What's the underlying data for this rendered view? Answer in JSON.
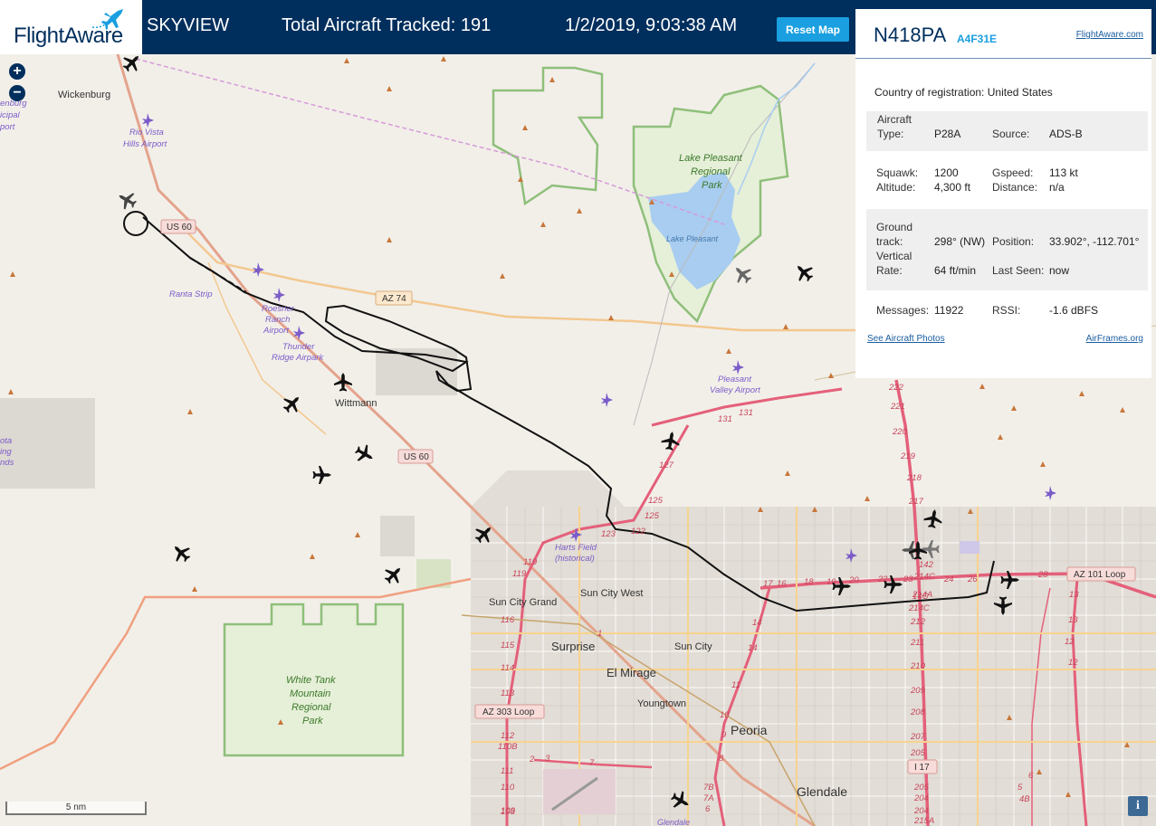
{
  "header": {
    "logo_text": "FlightAware",
    "app_name": "SKYVIEW",
    "tracked_label": "Total Aircraft Tracked: 191",
    "datetime": "1/2/2019, 9:03:38 AM",
    "reset_label": "Reset Map"
  },
  "map": {
    "zoom_in": "+",
    "zoom_out": "−",
    "scale": "5 nm",
    "info": "i",
    "places": {
      "wickenburg": "Wickenburg",
      "wickenburg_muni_1": "enburg",
      "wickenburg_muni_2": "icipal",
      "wickenburg_muni_3": "port",
      "rio_vista_1": "Rio Vista",
      "rio_vista_2": "Hills Airport",
      "ranta": "Ranta Strip",
      "roesner_1": "Roesner",
      "roesner_2": "Ranch",
      "roesner_3": "Airport",
      "thunder_1": "Thunder",
      "thunder_2": "Ridge Airpark",
      "wittmann": "Wittmann",
      "lake_park_1": "Lake Pleasant",
      "lake_park_2": "Regional",
      "lake_park_3": "Park",
      "lake": "Lake Pleasant",
      "pleasant_valley_1": "Pleasant",
      "pleasant_valley_2": "Valley Airport",
      "harts_1": "Harts Field",
      "harts_2": "(historical)",
      "sun_city_grand": "Sun City Grand",
      "sun_city_west": "Sun City West",
      "surprise": "Surprise",
      "sun_city": "Sun City",
      "el_mirage": "El Mirage",
      "youngtown": "Youngtown",
      "peoria": "Peoria",
      "glendale": "Glendale",
      "glendale_small": "Glendale",
      "white_tank_1": "White Tank",
      "white_tank_2": "Mountain",
      "white_tank_3": "Regional",
      "white_tank_4": "Park",
      "left_edge_1": "ota",
      "left_edge_2": "ing",
      "left_edge_3": "nds"
    },
    "shields": {
      "us60_a": "US 60",
      "us60_b": "US 60",
      "az74": "AZ 74",
      "az101": "AZ 101 Loop",
      "az303": "AZ 303 Loop",
      "i17": "I 17"
    },
    "exits": [
      "222",
      "221",
      "220",
      "219",
      "218",
      "217",
      "131",
      "131",
      "127",
      "125",
      "125",
      "123",
      "122",
      "119",
      "119",
      "116",
      "115",
      "114",
      "113",
      "112",
      "110B",
      "111",
      "110",
      "109",
      "108",
      "17",
      "16",
      "18",
      "19",
      "20",
      "22",
      "23",
      "24",
      "26",
      "28",
      "14",
      "14",
      "13",
      "13",
      "12",
      "12",
      "11",
      "10",
      "9",
      "8",
      "7B",
      "7A",
      "6",
      "212",
      "211",
      "210",
      "209",
      "208",
      "207",
      "205",
      "205",
      "204",
      "204",
      "215A",
      "214C",
      "214A",
      "214C",
      "14C",
      "142",
      "1",
      "2",
      "3",
      "7",
      "6",
      "5",
      "4B"
    ]
  },
  "panel": {
    "registration": "N418PA",
    "hex": "A4F31E",
    "fa_link": "FlightAware.com",
    "country_label": "Country of registration:",
    "country": "United States",
    "aircraft_type_label_1": "Aircraft",
    "aircraft_type_label_2": "Type:",
    "aircraft_type": "P28A",
    "source_label": "Source:",
    "source": "ADS-B",
    "squawk_label": "Squawk:",
    "squawk": "1200",
    "gspeed_label": "Gspeed:",
    "gspeed": "113 kt",
    "altitude_label": "Altitude:",
    "altitude": "4,300 ft",
    "distance_label": "Distance:",
    "distance": "n/a",
    "ground_label_1": "Ground",
    "ground_label_2": "track:",
    "ground_track": "298° (NW)",
    "position_label": "Position:",
    "position": "33.902°, -112.701°",
    "vertical_label_1": "Vertical",
    "vertical_label_2": "Rate:",
    "vertical_rate": "64 ft/min",
    "last_seen_label": "Last Seen:",
    "last_seen": "now",
    "messages_label": "Messages:",
    "messages": "11922",
    "rssi_label": "RSSI:",
    "rssi": "-1.6 dBFS",
    "photos_link": "See Aircraft Photos",
    "airframes_link": "AirFrames.org"
  },
  "colors": {
    "header_bg": "#002f5d",
    "accent": "#1a9fe0",
    "park_green": "#8fbf7a",
    "water": "#a8cdf0",
    "motorway": "#e4607a",
    "primary_road": "#f0b070",
    "airport_purple": "#7b5cc9",
    "peak_brown": "#c8763a"
  }
}
